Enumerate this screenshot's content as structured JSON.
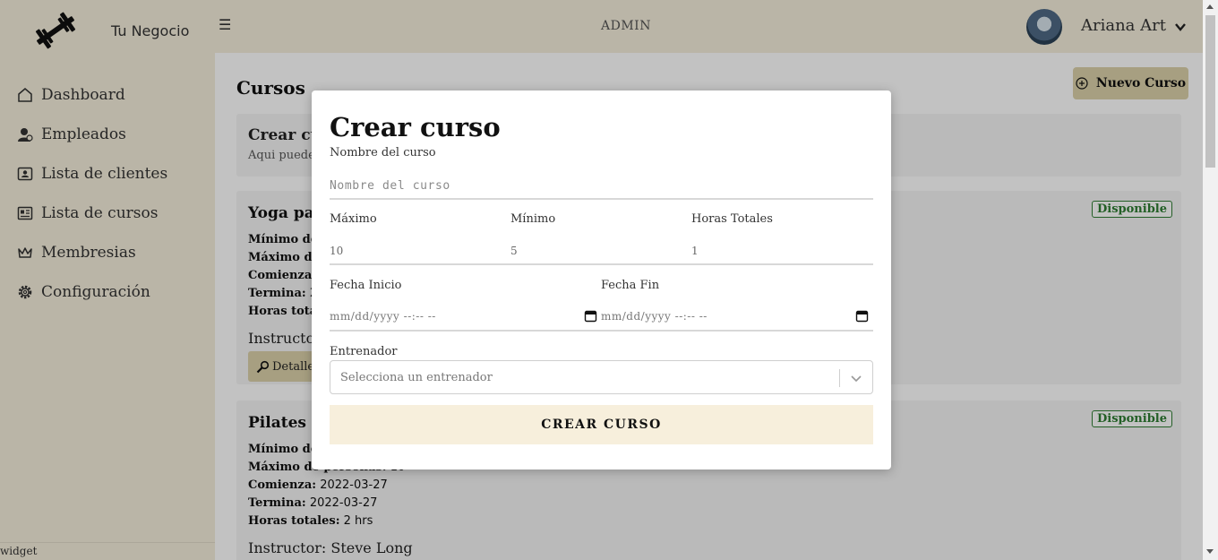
{
  "header": {
    "brand": "Tu Negocio",
    "menu_icon": "☰",
    "role": "ADMIN",
    "user_name": "Ariana Art"
  },
  "sidebar": {
    "items": [
      {
        "label": "Dashboard",
        "icon": "house-icon"
      },
      {
        "label": "Empleados",
        "icon": "user-badge-icon"
      },
      {
        "label": "Lista de clientes",
        "icon": "contact-card-icon"
      },
      {
        "label": "Lista de cursos",
        "icon": "newspaper-icon"
      },
      {
        "label": "Membresias",
        "icon": "crown-icon"
      },
      {
        "label": "Configuración",
        "icon": "gear-icon"
      }
    ],
    "widget_label": "widget"
  },
  "main": {
    "title": "Cursos",
    "new_button": "Nuevo Curso",
    "create_card": {
      "title": "Crear curso",
      "subtitle": "Aqui puedes"
    },
    "courses": [
      {
        "name": "Yoga para",
        "status": "Disponible",
        "rows": [
          {
            "label": "Mínimo de p",
            "value": ""
          },
          {
            "label": "Máximo de",
            "value": ""
          },
          {
            "label": "Comienza:",
            "value": "2"
          },
          {
            "label": "Termina:",
            "value": "20"
          },
          {
            "label": "Horas totale",
            "value": ""
          }
        ],
        "instructor": "Instructor",
        "detail_button": "Detalle"
      },
      {
        "name": "Pilates",
        "status": "Disponible",
        "rows": [
          {
            "label": "Mínimo de p",
            "value": ""
          },
          {
            "label": "Máximo de personas:",
            "value": "10"
          },
          {
            "label": "Comienza:",
            "value": "2022-03-27"
          },
          {
            "label": "Termina:",
            "value": "2022-03-27"
          },
          {
            "label": "Horas totales:",
            "value": "2 hrs"
          }
        ],
        "instructor": "Instructor: Steve Long",
        "detail_button": "Detalle"
      }
    ]
  },
  "modal": {
    "title": "Crear curso",
    "name_label": "Nombre del curso",
    "name_placeholder": "Nombre del curso",
    "max_label": "Máximo",
    "max_value": "10",
    "min_label": "Mínimo",
    "min_value": "5",
    "hours_label": "Horas Totales",
    "hours_value": "1",
    "start_label": "Fecha Inicio",
    "start_placeholder": "mm/dd/yyyy --:-- --",
    "end_label": "Fecha Fin",
    "end_placeholder": "mm/dd/yyyy --:-- --",
    "trainer_label": "Entrenador",
    "trainer_placeholder": "Selecciona un entrenador",
    "submit_label": "CREAR CURSO"
  },
  "colors": {
    "header_bg": "#f5eedc",
    "button_bg": "#dcd2aa",
    "submit_bg": "#f7efdc",
    "badge_green": "#2e7d32"
  }
}
